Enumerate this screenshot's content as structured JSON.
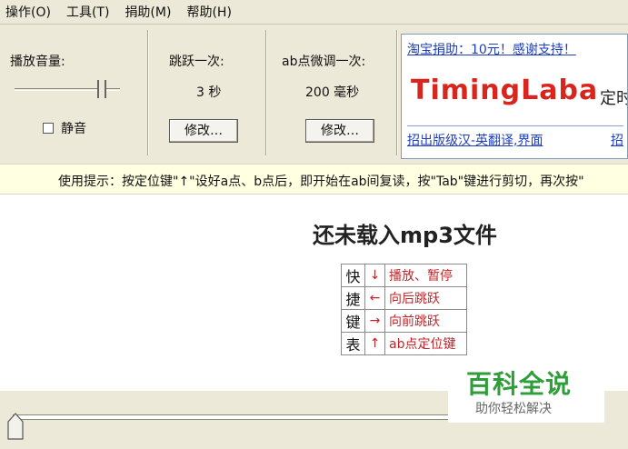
{
  "menu": [
    "操作(O)",
    "工具(T)",
    "捐助(M)",
    "帮助(H)"
  ],
  "volume": {
    "label": "播放音量:",
    "level": 0.8,
    "mute_label": "静音",
    "muted": false
  },
  "jump": {
    "label": "跳跃一次:",
    "value": "3  秒",
    "button": "修改…"
  },
  "ab_adjust": {
    "label": "ab点微调一次:",
    "value": "200  毫秒",
    "button": "修改…"
  },
  "ad": {
    "donate_link": "淘宝捐助：10元！感谢支持！",
    "brand": "TimingLaba",
    "brand_tail": "定时",
    "link_bottom": "招出版级汉-英翻译,界面",
    "link_bottom_tail": "招"
  },
  "tip": "使用提示：按定位键\"↑\"设好a点、b点后，即开始在ab间复读，按\"Tab\"键进行剪切，再次按\"",
  "status": "还未载入mp3文件",
  "shortcut_table": {
    "title_chars": [
      "快",
      "捷",
      "键",
      "表"
    ],
    "rows": [
      {
        "arrow": "↓",
        "desc": "播放、暂停"
      },
      {
        "arrow": "←",
        "desc": "向后跳跃"
      },
      {
        "arrow": "→",
        "desc": "向前跳跃"
      },
      {
        "arrow": "↑",
        "desc": "ab点定位键"
      }
    ]
  },
  "watermark": {
    "title": "百科全说",
    "subtitle": "助你轻松解决"
  },
  "seek": {
    "position": 0
  },
  "colors": {
    "chrome": "#ece9d8",
    "tip_bg": "#ffffe1",
    "link": "#1f3fb8",
    "brand_red": "#d8261e",
    "watermark_green": "#2f9e3a"
  }
}
